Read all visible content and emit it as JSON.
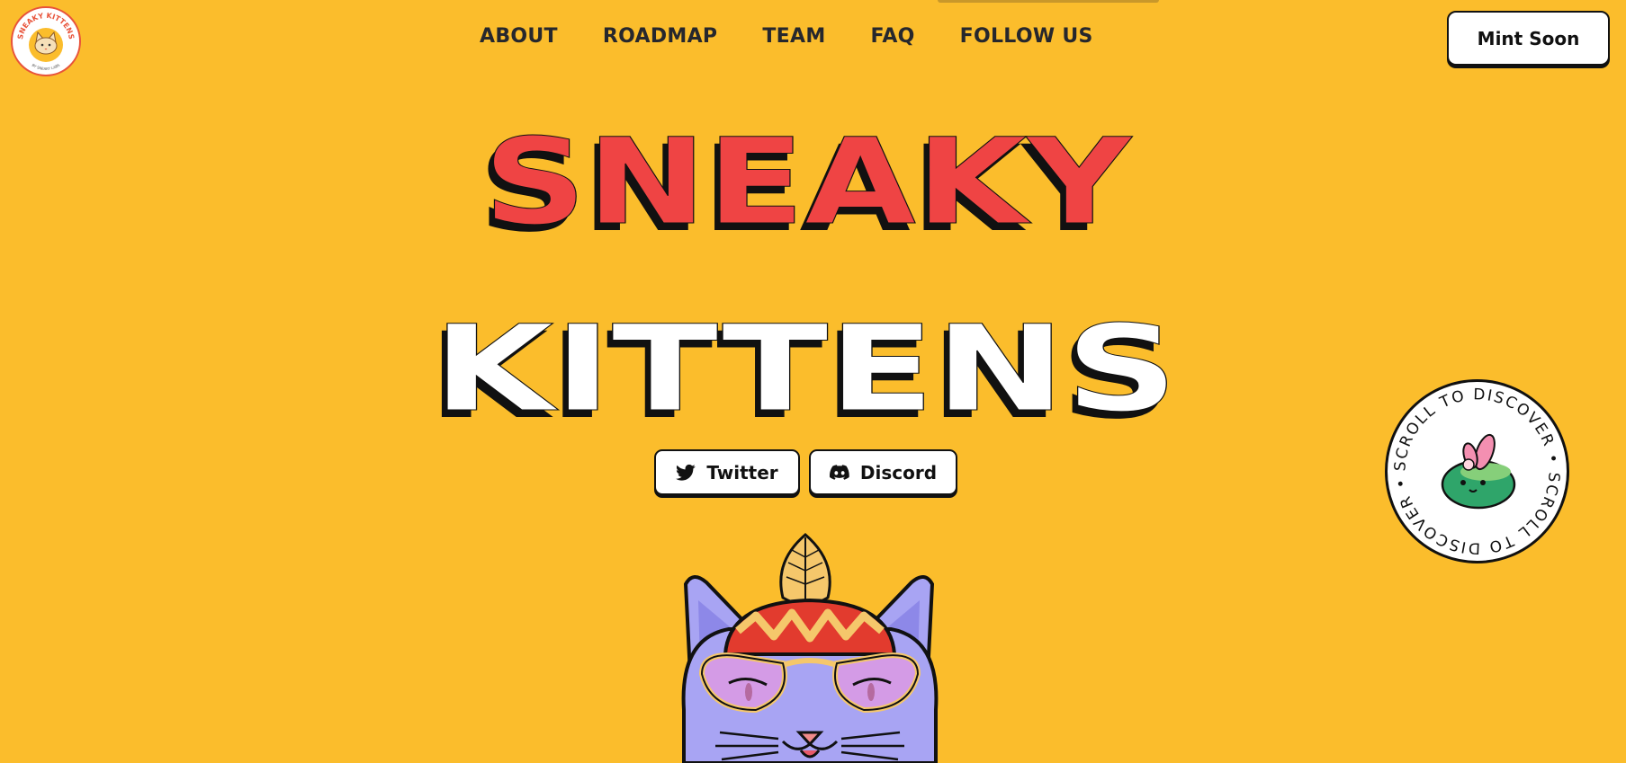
{
  "header": {
    "logo_alt": "Sneaky Kittens logo",
    "logo_text_top": "SNEAKY KITTENS",
    "logo_text_bottom": "BY SNEAKY LABS",
    "nav": [
      {
        "label": "ABOUT"
      },
      {
        "label": "ROADMAP"
      },
      {
        "label": "TEAM"
      },
      {
        "label": "FAQ"
      },
      {
        "label": "FOLLOW US"
      }
    ],
    "mint_label": "Mint Soon"
  },
  "hero": {
    "title_line1": "SNEAKY",
    "title_line2": "KITTENS",
    "title_line1_color": "#ef4444",
    "title_line2_color": "#ffffff",
    "twitter_label": "Twitter",
    "discord_label": "Discord"
  },
  "scroll_badge": {
    "text": "SCROLL TO DISCOVER • SCROLL TO DISCOVER •"
  },
  "colors": {
    "background": "#fbbd2c",
    "nav_text": "#26272d",
    "button_bg": "#ffffff",
    "outline": "#111111"
  },
  "icons": [
    "twitter-icon",
    "discord-icon",
    "cat-illustration",
    "frog-mascot"
  ]
}
